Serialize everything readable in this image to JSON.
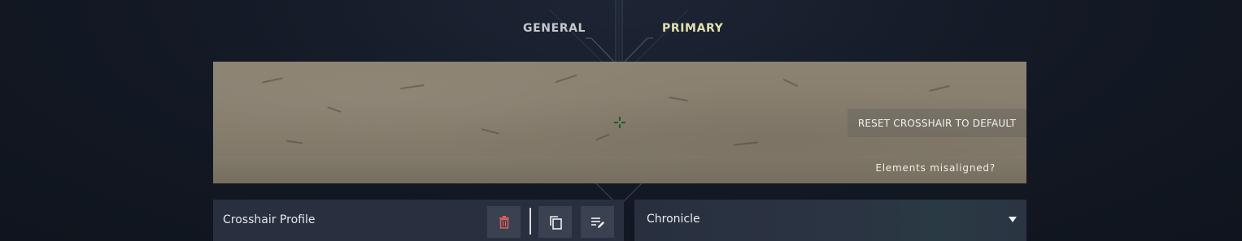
{
  "tabs": [
    {
      "label": "GENERAL",
      "active": false
    },
    {
      "label": "PRIMARY",
      "active": true
    }
  ],
  "preview": {
    "reset_label": "RESET CROSSHAIR TO DEFAULT",
    "misaligned_label": "Elements misaligned?",
    "crosshair_color": "#1f5a2a"
  },
  "profile": {
    "label": "Crosshair Profile",
    "delete_icon": "trash-icon",
    "copy_icon": "copy-icon",
    "rename_icon": "edit-list-icon",
    "delete_color": "#e0605a"
  },
  "profile_select": {
    "value": "Chronicle"
  },
  "colors": {
    "active_tab": "#e4e0b0",
    "inactive_tab": "#c5c8cc",
    "panel": "#283040"
  }
}
